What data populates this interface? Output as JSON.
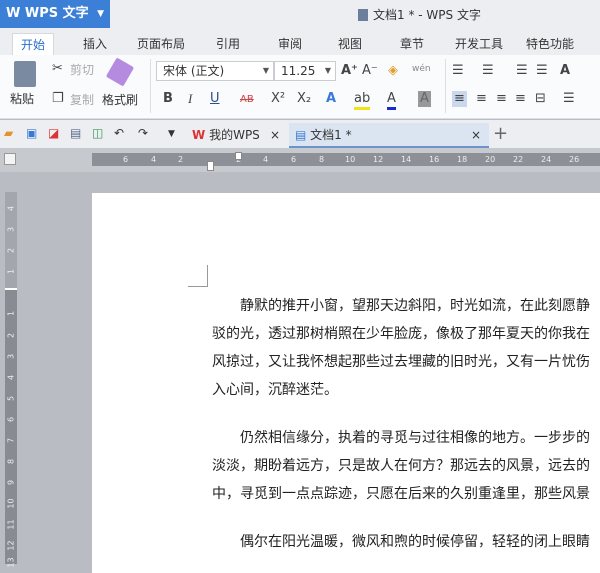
{
  "app": {
    "logo": "W WPS 文字",
    "window_title": "文档1 * - WPS 文字"
  },
  "menu_tabs": [
    "开始",
    "插入",
    "页面布局",
    "引用",
    "审阅",
    "视图",
    "章节",
    "开发工具",
    "特色功能"
  ],
  "ribbon": {
    "paste": "粘贴",
    "cut": "剪切",
    "copy": "复制",
    "format_painter": "格式刷",
    "font_name": "宋体 (正文)",
    "font_size": "11.25",
    "bold": "B",
    "italic": "I",
    "underline": "U",
    "strike": "AB",
    "superscript": "X²",
    "subscript": "X₂",
    "grow": "A⁺",
    "shrink": "A⁻",
    "phonetic": "wén"
  },
  "doc_tabs": [
    {
      "label": "我的WPS"
    },
    {
      "label": "文档1 *"
    }
  ],
  "ruler": {
    "h": [
      "6",
      "4",
      "2",
      "2",
      "4",
      "6",
      "8",
      "10",
      "12",
      "14",
      "16",
      "18",
      "20",
      "22",
      "24",
      "26"
    ],
    "v_top": [
      "4",
      "3",
      "2",
      "1"
    ],
    "v": [
      "1",
      "2",
      "3",
      "4",
      "5",
      "6",
      "7",
      "8",
      "9",
      "10",
      "11",
      "12",
      "13"
    ]
  },
  "document": {
    "paragraphs": [
      [
        "静默的推开小窗，望那天边斜阳，时光如流，在此刻愿静",
        "驳的光，透过那树梢照在少年脸庞，像极了那年夏天的你我在",
        "风掠过，又让我怀想起那些过去埋藏的旧时光，又有一片忧伤",
        "入心间，沉醉迷茫。"
      ],
      [
        "仍然相信缘分，执着的寻觅与过往相像的地方。一步步的",
        "淡淡，期盼着远方，只是故人在何方？那远去的风景，远去的",
        "中，寻觅到一点点踪迹，只愿在后来的久别重逢里，那些风景"
      ],
      [
        "偶尔在阳光温暖，微风和煦的时候停留，轻轻的闭上眼睛"
      ]
    ]
  }
}
